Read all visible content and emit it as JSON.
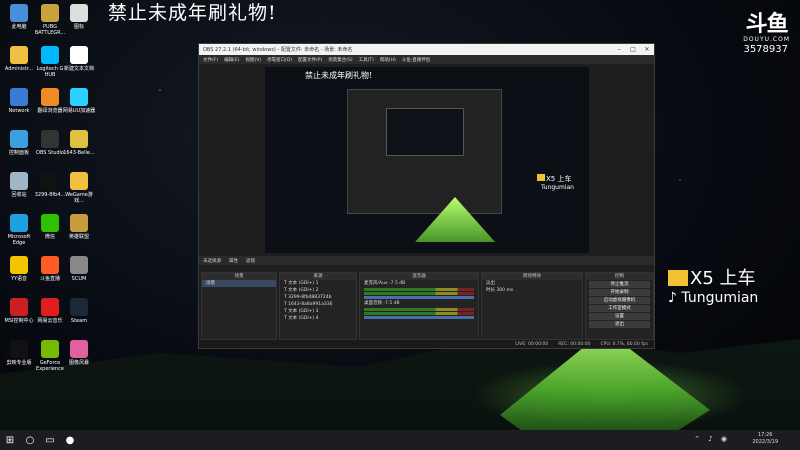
{
  "stream": {
    "title": "禁止未成年刷礼物!",
    "platform_logo": "斗鱼",
    "platform_domain": "DOUYU.COM",
    "room_id": "3578937",
    "overlay_x5": "X5 上车",
    "overlay_tg": "Tungumian"
  },
  "desktop_icons": [
    {
      "label": "此电脑",
      "color": "#4a90d9"
    },
    {
      "label": "PUBG BATTLEGR...",
      "color": "#c8a23a"
    },
    {
      "label": "图标",
      "color": "#ddd"
    },
    {
      "label": "Administr...",
      "color": "#f0c040"
    },
    {
      "label": "Logitech G HUB",
      "color": "#00b8fc"
    },
    {
      "label": "新建文本文档",
      "color": "#fff"
    },
    {
      "label": "Network",
      "color": "#3a7bd5"
    },
    {
      "label": "翻译浏览器",
      "color": "#f08a24"
    },
    {
      "label": "网易UU加速器",
      "color": "#2ad0ff"
    },
    {
      "label": "控制面板",
      "color": "#3aa0e0"
    },
    {
      "label": "OBS Studio",
      "color": "#333"
    },
    {
      "label": "1643-Belle...",
      "color": "#e0c040"
    },
    {
      "label": "回收站",
      "color": "#9fb5c8"
    },
    {
      "label": "3299-8fb4...",
      "color": "#111"
    },
    {
      "label": "WeGame游戏...",
      "color": "#f0c040"
    },
    {
      "label": "Microsoft Edge",
      "color": "#1fa0e0"
    },
    {
      "label": "微信",
      "color": "#2dc100"
    },
    {
      "label": "英雄联盟",
      "color": "#c89b3c"
    },
    {
      "label": "YY语音",
      "color": "#f5c400"
    },
    {
      "label": "斗鱼直播",
      "color": "#ff5d23"
    },
    {
      "label": "SCUM",
      "color": "#888"
    },
    {
      "label": "MSI控制中心",
      "color": "#cc2020"
    },
    {
      "label": "网易云音乐",
      "color": "#e01e1e"
    },
    {
      "label": "Steam",
      "color": "#1b2838"
    },
    {
      "label": "剪映专业版",
      "color": "#111"
    },
    {
      "label": "GeForce Experience",
      "color": "#76b900"
    },
    {
      "label": "图像风暴",
      "color": "#e060a0"
    }
  ],
  "obs": {
    "title": "OBS 27.2.1 (64-bit, windows) - 配置文件: 未命名 - 场景: 未命名",
    "menu": [
      "文件(F)",
      "编辑(E)",
      "视图(V)",
      "停靠窗口(D)",
      "配置文件(P)",
      "场景集合(S)",
      "工具(T)",
      "帮助(H)",
      "斗鱼·直播伴侣"
    ],
    "toolbar": {
      "source_label": "未选择源",
      "properties": "属性",
      "filters": "滤镜"
    },
    "docks": {
      "scenes": {
        "header": "场景",
        "items": [
          "场景"
        ]
      },
      "sources": {
        "header": "来源",
        "items": [
          "文本 (GDI+) 1",
          "文本 (GDI+) 2",
          "3299-8fb4883724b",
          "1643-8a8a991a336",
          "文本 (GDI+) 3",
          "文本 (GDI+) 4"
        ]
      },
      "mixer": {
        "header": "混音器",
        "tracks": [
          {
            "name": "麦克风/Aux",
            "db": "-7.5 dB"
          },
          {
            "name": "桌面音频",
            "db": "-7.5 dB"
          }
        ]
      },
      "transitions": {
        "header": "转场特效",
        "type": "淡出",
        "duration_label": "时长",
        "duration": "300 ms"
      },
      "controls": {
        "header": "控制",
        "buttons": [
          "停止推流",
          "开始录制",
          "启动虚拟摄像机",
          "工作室模式",
          "设置",
          "退出"
        ]
      }
    },
    "status": {
      "live": "LIVE: 00:00:00",
      "rec": "REC: 00:00:00",
      "cpu": "CPU: 0.7%, 60.00 fps"
    },
    "preview_overlay": {
      "title": "禁止未成年刷礼物!",
      "x5": "X5 上车",
      "tg": "Tungumian"
    }
  },
  "taskbar": {
    "time": "17:26",
    "date": "2022/3/19"
  }
}
